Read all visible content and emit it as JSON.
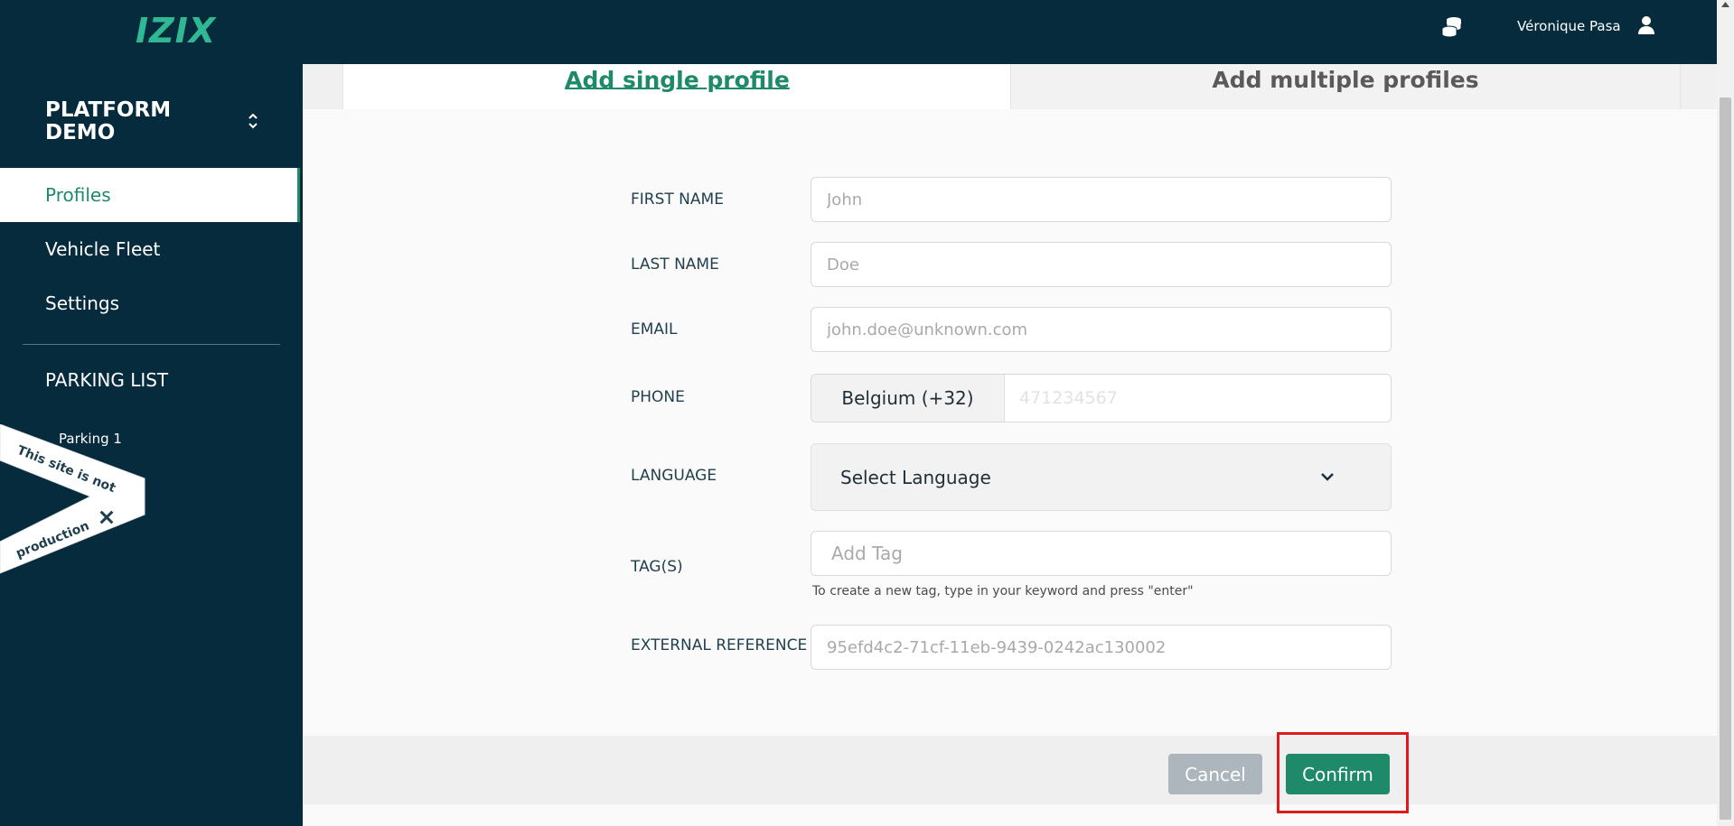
{
  "header": {
    "logo_text": "IZIX",
    "user_name": "Véronique Pasa",
    "coins_icon": "coins-stack-icon",
    "user_icon": "user-icon"
  },
  "sidebar": {
    "workspace": "PLATFORM DEMO",
    "items": [
      {
        "label": "Profiles",
        "active": true
      },
      {
        "label": "Vehicle Fleet",
        "active": false
      },
      {
        "label": "Settings",
        "active": false
      }
    ],
    "section_title": "PARKING LIST",
    "parkings": [
      "Parking 1"
    ]
  },
  "ribbon": {
    "line1": "This site is not",
    "line2": "production",
    "icon": "tools-icon"
  },
  "tabs": {
    "single": "Add single profile",
    "multiple": "Add multiple profiles"
  },
  "form": {
    "first_name": {
      "label": "FIRST NAME",
      "placeholder": "John"
    },
    "last_name": {
      "label": "LAST NAME",
      "placeholder": "Doe"
    },
    "email": {
      "label": "EMAIL",
      "placeholder": "john.doe@unknown.com"
    },
    "phone": {
      "label": "PHONE",
      "country": "Belgium (+32)",
      "placeholder": "471234567"
    },
    "language": {
      "label": "LANGUAGE",
      "value": "Select Language"
    },
    "tags": {
      "label": "TAG(S)",
      "placeholder": "Add Tag",
      "help": "To create a new tag, type in your keyword and press \"enter\""
    },
    "external_reference": {
      "label": "EXTERNAL REFERENCE",
      "placeholder": "95efd4c2-71cf-11eb-9439-0242ac130002"
    }
  },
  "actions": {
    "cancel": "Cancel",
    "confirm": "Confirm"
  },
  "colors": {
    "navy": "#062b3d",
    "accent_green": "#1e8a6a",
    "highlight_red": "#e01a1a"
  }
}
